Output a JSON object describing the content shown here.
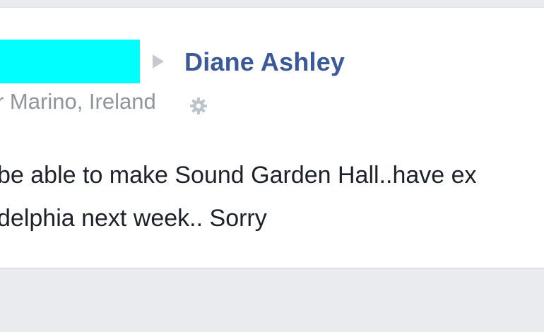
{
  "post": {
    "recipient_name": "Diane Ashley",
    "location_text": "r Marino, Ireland",
    "message_lines": [
      "be able to make Sound Garden Hall..have ex",
      "delphia next week.. Sorry"
    ]
  },
  "icons": {
    "arrow": "triangle-right-icon",
    "settings": "gear-icon"
  },
  "colors": {
    "redaction": "#00ffff",
    "link": "#3b5998",
    "muted": "#90949c",
    "text": "#1d2129",
    "background": "#e9ebee"
  }
}
